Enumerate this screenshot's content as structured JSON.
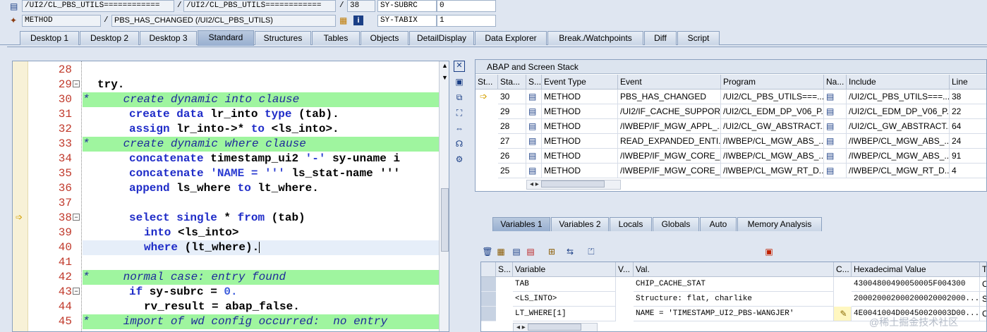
{
  "header": {
    "row1": {
      "field1": "/UI2/CL_PBS_UTILS============",
      "field2": "/UI2/CL_PBS_UTILS============",
      "field3": "38",
      "var_name": "SY-SUBRC",
      "var_value": "0"
    },
    "row2": {
      "field1": "METHOD",
      "field2": "PBS_HAS_CHANGED (/UI2/CL_PBS_UTILS)",
      "var_name": "SY-TABIX",
      "var_value": "1"
    },
    "sep": "/"
  },
  "tabs": [
    "Desktop 1",
    "Desktop 2",
    "Desktop 3",
    "Standard",
    "Structures",
    "Tables",
    "Objects",
    "DetailDisplay",
    "Data Explorer",
    "Break./Watchpoints",
    "Diff",
    "Script"
  ],
  "editor": {
    "lines": [
      "28",
      "29",
      "30",
      "31",
      "32",
      "33",
      "34",
      "35",
      "36",
      "37",
      "38",
      "39",
      "40",
      "41",
      "42",
      "43",
      "44",
      "45"
    ],
    "code": {
      "l29": "try.",
      "l30": "*     create dynamic into clause",
      "l31a": "create data",
      "l31b": " lr_into ",
      "l31c": "type",
      "l31d": " (tab).",
      "l32a": "assign",
      "l32b": " lr_into->* ",
      "l32c": "to",
      "l32d": " <ls_into>.",
      "l33": "*     create dynamic where clause",
      "l34a": "concatenate",
      "l34b": " timestamp_ui2 ",
      "l34c": "'-'",
      "l34d": " sy-uname i",
      "l35a": "concatenate",
      "l35b": " 'NAME = '''",
      "l35c": " ls_stat-name '''",
      "l36a": "append",
      "l36b": " ls_where ",
      "l36c": "to",
      "l36d": " lt_where.",
      "l38a": "select single",
      "l38b": " * ",
      "l38c": "from",
      "l38d": " (tab)",
      "l39a": "into",
      "l39b": " <ls_into>",
      "l40a": "where",
      "l40b": " (lt_where).",
      "l42": "*     normal case: entry found",
      "l43a": "if",
      "l43b": " sy-subrc ",
      "l43c": "=",
      "l43d": " 0.",
      "l44a": "rv_result = abap_false.",
      "l45": "*     import of wd config occurred:  no entry"
    }
  },
  "stack": {
    "title": "ABAP and Screen Stack",
    "headers": [
      "St...",
      "Sta...",
      "S...",
      "Event Type",
      "Event",
      "Program",
      "Na...",
      "Include",
      "Line"
    ],
    "rows": [
      {
        "level": "30",
        "type": "METHOD",
        "event": "PBS_HAS_CHANGED",
        "program": "/UI2/CL_PBS_UTILS===...",
        "include": "/UI2/CL_PBS_UTILS===...",
        "line": "38"
      },
      {
        "level": "29",
        "type": "METHOD",
        "event": "/UI2/IF_CACHE_SUPPOR...",
        "program": "/UI2/CL_EDM_DP_V06_P...",
        "include": "/UI2/CL_EDM_DP_V06_P...",
        "line": "22"
      },
      {
        "level": "28",
        "type": "METHOD",
        "event": "/IWBEP/IF_MGW_APPL_...",
        "program": "/UI2/CL_GW_ABSTRACT...",
        "include": "/UI2/CL_GW_ABSTRACT...",
        "line": "64"
      },
      {
        "level": "27",
        "type": "METHOD",
        "event": "READ_EXPANDED_ENTI...",
        "program": "/IWBEP/CL_MGW_ABS_...",
        "include": "/IWBEP/CL_MGW_ABS_...",
        "line": "24"
      },
      {
        "level": "26",
        "type": "METHOD",
        "event": "/IWBEP/IF_MGW_CORE_...",
        "program": "/IWBEP/CL_MGW_ABS_...",
        "include": "/IWBEP/CL_MGW_ABS_...",
        "line": "91"
      },
      {
        "level": "25",
        "type": "METHOD",
        "event": "/IWBEP/IF_MGW_CORE_...",
        "program": "/IWBEP/CL_MGW_RT_D...",
        "include": "/IWBEP/CL_MGW_RT_D...",
        "line": "4"
      }
    ]
  },
  "vartabs": [
    "Variables 1",
    "Variables 2",
    "Locals",
    "Globals",
    "Auto",
    "Memory Analysis"
  ],
  "vars": {
    "headers": [
      "S...",
      "Variable",
      "V...",
      "Val.",
      "C...",
      "Hexadecimal Value",
      "T"
    ],
    "rows": [
      {
        "name": "TAB",
        "val": "CHIP_CACHE_STAT",
        "hex": "43004800490050005F004300",
        "t": "C"
      },
      {
        "name": "<LS_INTO>",
        "val": "Structure: flat, charlike",
        "hex": "200020002000200020002000...",
        "t": "S"
      },
      {
        "name": "LT_WHERE[1]",
        "val": "NAME = 'TIMESTAMP_UI2_PBS-WANGJER'",
        "hex": "4E0041004D00450020003D00...",
        "t": "C"
      }
    ]
  },
  "watermark": "@稀土掘金技术社区"
}
